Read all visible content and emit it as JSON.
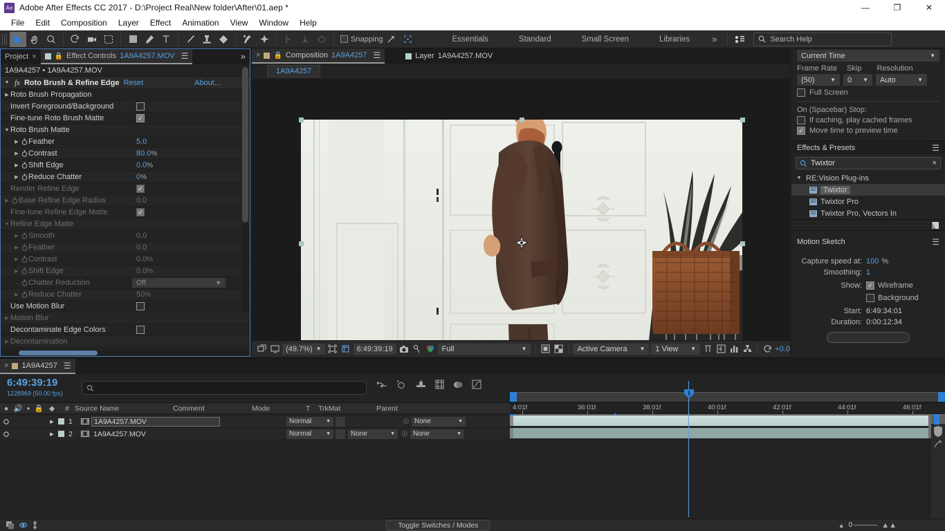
{
  "window": {
    "app_badge": "Ae",
    "title": "Adobe After Effects CC 2017 - D:\\Project Real\\New folder\\After\\01.aep *",
    "buttons": {
      "minimize": "—",
      "maximize": "❐",
      "close": "✕"
    }
  },
  "menubar": [
    "File",
    "Edit",
    "Composition",
    "Layer",
    "Effect",
    "Animation",
    "View",
    "Window",
    "Help"
  ],
  "toolbar": {
    "snapping_label": "Snapping",
    "workspaces": [
      "Essentials",
      "Standard",
      "Small Screen",
      "Libraries"
    ],
    "workspace_more": "»",
    "search_help_placeholder": "Search Help"
  },
  "effect_controls": {
    "tabs": [
      {
        "label": "Project",
        "active": false
      },
      {
        "label": "Effect Controls",
        "file": "1A9A4257.MOV",
        "active": true
      }
    ],
    "breadcrumb": "1A9A4257 • 1A9A4257.MOV",
    "effect_title": "Roto Brush & Refine Edge",
    "effect_fx": "fx",
    "reset_label": "Reset",
    "about_label": "About...",
    "properties": [
      {
        "label": "Roto Brush Propagation",
        "type": "group",
        "expanded": false,
        "indent": 1,
        "dim": false
      },
      {
        "label": "Invert Foreground/Background",
        "type": "checkbox",
        "checked": false,
        "indent": 1,
        "dim": false
      },
      {
        "label": "Fine-tune Roto Brush Matte",
        "type": "checkbox",
        "checked": true,
        "indent": 1,
        "dim": false
      },
      {
        "label": "Roto Brush Matte",
        "type": "group",
        "expanded": true,
        "indent": 1,
        "dim": false
      },
      {
        "label": "Feather",
        "type": "value",
        "value": "5.0",
        "unit": "",
        "indent": 2,
        "stopwatch": true,
        "dim": false
      },
      {
        "label": "Contrast",
        "type": "value",
        "value": "80.0",
        "unit": "%",
        "indent": 2,
        "stopwatch": true,
        "dim": false
      },
      {
        "label": "Shift Edge",
        "type": "value",
        "value": "0.0",
        "unit": "%",
        "indent": 2,
        "stopwatch": true,
        "dim": false
      },
      {
        "label": "Reduce Chatter",
        "type": "value",
        "value": "0",
        "unit": "%",
        "indent": 2,
        "stopwatch": true,
        "dim": false
      },
      {
        "label": "Render Refine Edge",
        "type": "checkbox",
        "checked": true,
        "indent": 1,
        "dim": true
      },
      {
        "label": "Base Refine Edge Radius",
        "type": "value",
        "value": "0.0",
        "unit": "",
        "indent": 1,
        "stopwatch": true,
        "dim": true
      },
      {
        "label": "Fine-tune Refine Edge Matte",
        "type": "checkbox",
        "checked": true,
        "indent": 1,
        "dim": true
      },
      {
        "label": "Refine Edge Matte",
        "type": "group",
        "expanded": true,
        "indent": 1,
        "dim": true
      },
      {
        "label": "Smooth",
        "type": "value",
        "value": "0.0",
        "unit": "",
        "indent": 2,
        "stopwatch": true,
        "dim": true
      },
      {
        "label": "Feather",
        "type": "value",
        "value": "0.0",
        "unit": "",
        "indent": 2,
        "stopwatch": true,
        "dim": true
      },
      {
        "label": "Contrast",
        "type": "value",
        "value": "0.0",
        "unit": "%",
        "indent": 2,
        "stopwatch": true,
        "dim": true
      },
      {
        "label": "Shift Edge",
        "type": "value",
        "value": "0.0",
        "unit": "%",
        "indent": 2,
        "stopwatch": true,
        "dim": true
      },
      {
        "label": "Chatter Reduction",
        "type": "dropdown",
        "value": "Off",
        "indent": 2,
        "stopwatch": true,
        "dim": true
      },
      {
        "label": "Reduce Chatter",
        "type": "value",
        "value": "50",
        "unit": "%",
        "indent": 2,
        "stopwatch": true,
        "dim": true
      },
      {
        "label": "Use Motion Blur",
        "type": "checkbox",
        "checked": false,
        "indent": 1,
        "dim": false
      },
      {
        "label": "Motion Blur",
        "type": "group",
        "expanded": false,
        "indent": 1,
        "dim": true
      },
      {
        "label": "Decontaminate Edge Colors",
        "type": "checkbox",
        "checked": false,
        "indent": 1,
        "dim": false
      },
      {
        "label": "Decontamination",
        "type": "group",
        "expanded": false,
        "indent": 1,
        "dim": true
      }
    ]
  },
  "composition": {
    "tabs": [
      {
        "label": "Composition",
        "name": "1A9A4257",
        "active": true
      },
      {
        "label": "Layer",
        "name": "1A9A4257.MOV",
        "active": false
      }
    ],
    "comp_chip": "1A9A4257",
    "footer": {
      "zoom": "(49.7%)",
      "timecode": "6:49:39:19",
      "resolution": "Full",
      "camera": "Active Camera",
      "views": "1 View",
      "exposure": "+0.0"
    }
  },
  "preview": {
    "current_time_label": "Current Time",
    "frame_rate_label": "Frame Rate",
    "frame_rate_value": "(50)",
    "skip_label": "Skip",
    "skip_value": "0",
    "resolution_label": "Resolution",
    "resolution_value": "Auto",
    "full_screen_label": "Full Screen",
    "full_screen_checked": false,
    "on_spacebar_label": "On (Spacebar) Stop:",
    "if_caching_label": "If caching, play cached frames",
    "if_caching_checked": false,
    "move_time_label": "Move time to preview time",
    "move_time_checked": true
  },
  "effects_presets": {
    "title": "Effects & Presets",
    "search_value": "Twixtor",
    "group": "RE:Vision Plug-ins",
    "items": [
      {
        "label": "Twixtor",
        "selected": true
      },
      {
        "label": "Twixtor Pro",
        "selected": false
      },
      {
        "label": "Twixtor Pro, Vectors In",
        "selected": false
      }
    ]
  },
  "motion_sketch": {
    "title": "Motion Sketch",
    "capture_speed_label": "Capture speed at:",
    "capture_speed_value": "100",
    "capture_speed_unit": "%",
    "smoothing_label": "Smoothing:",
    "smoothing_value": "1",
    "show_label": "Show:",
    "wireframe_label": "Wireframe",
    "wireframe_checked": true,
    "background_label": "Background",
    "background_checked": false,
    "start_label": "Start:",
    "start_value": "6:49:34:01",
    "duration_label": "Duration:",
    "duration_value": "0:00:12:34"
  },
  "timeline": {
    "tab_label": "1A9A4257",
    "current_time": "6:49:39:19",
    "frame_info": "1228969 (50.00 fps)",
    "search_placeholder": "",
    "columns": [
      "#",
      "Source Name",
      "Comment",
      "Mode",
      "T",
      "TrkMat",
      "Parent"
    ],
    "layers": [
      {
        "index": "1",
        "source_name": "1A9A4257.MOV",
        "comment": "",
        "mode": "Normal",
        "trkmat": "",
        "parent": "None",
        "selected": true
      },
      {
        "index": "2",
        "source_name": "1A9A4257.MOV",
        "comment": "",
        "mode": "Normal",
        "trkmat": "None",
        "parent": "None",
        "selected": false
      }
    ],
    "ruler_labels": [
      "4:01f",
      "36:01f",
      "38:01f",
      "40:01f",
      "42:01f",
      "44:01f",
      "46:01f"
    ],
    "toggle_switches_label": "Toggle Switches / Modes",
    "zoom_value": "0"
  }
}
